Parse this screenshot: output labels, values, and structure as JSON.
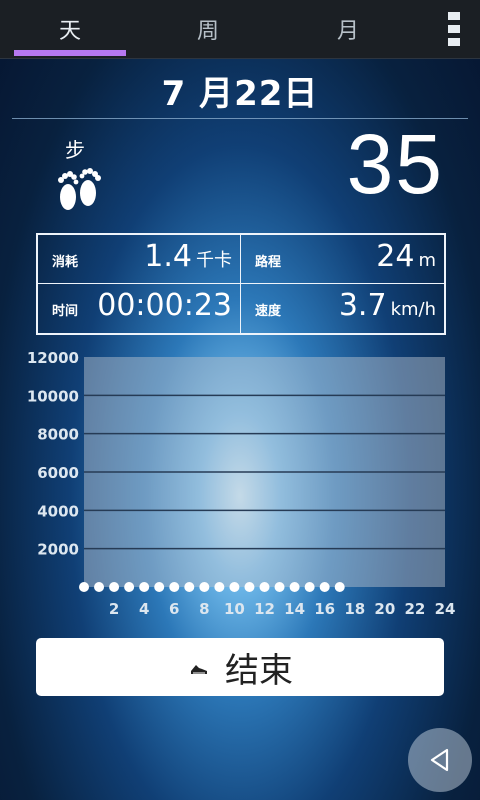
{
  "tabs": [
    {
      "label": "天"
    },
    {
      "label": "周"
    },
    {
      "label": "月"
    }
  ],
  "date": "7 月22日",
  "steps": {
    "label": "步",
    "count": "35"
  },
  "stats": {
    "calories": {
      "label": "消耗",
      "value": "1.4",
      "unit": "千卡"
    },
    "distance": {
      "label": "路程",
      "value": "24",
      "unit": "m"
    },
    "time": {
      "label": "时间",
      "value": "00:00:23",
      "unit": ""
    },
    "speed": {
      "label": "速度",
      "value": "3.7",
      "unit": "km/h"
    }
  },
  "chart_data": {
    "type": "line",
    "x": [
      0,
      1,
      2,
      3,
      4,
      5,
      6,
      7,
      8,
      9,
      10,
      11,
      12,
      13,
      14,
      15,
      16,
      17,
      18,
      19,
      20,
      21,
      22,
      23,
      24
    ],
    "series": [
      {
        "values": [
          0,
          0,
          0,
          0,
          0,
          0,
          0,
          0,
          0,
          0,
          0,
          0,
          0,
          0,
          0,
          0,
          0,
          0
        ]
      }
    ],
    "xticks": [
      "2",
      "4",
      "6",
      "8",
      "10",
      "12",
      "14",
      "16",
      "18",
      "20",
      "22",
      "24"
    ],
    "yticks": [
      "2000",
      "4000",
      "6000",
      "8000",
      "10000",
      "12000"
    ],
    "xlim": [
      0,
      24
    ],
    "ylim": [
      0,
      12000
    ],
    "grid": true,
    "colors": {
      "panel": "#b7c3ce",
      "grid": "#263b55",
      "marker": "#ffffff"
    }
  },
  "actions": {
    "end_label": "结束"
  },
  "icons": {
    "overflow": "overflow-menu-icon",
    "steps": "footprints-icon",
    "end": "running-shoe-icon",
    "back": "back-triangle-icon"
  }
}
